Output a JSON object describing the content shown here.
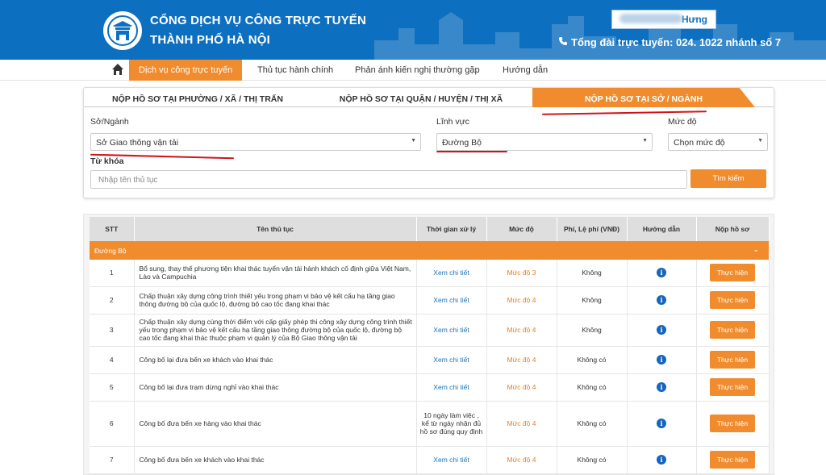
{
  "header": {
    "title_line1": "CỔNG DỊCH VỤ CÔNG TRỰC TUYẾN",
    "title_line2": "THÀNH PHỐ HÀ NỘI",
    "user_name": "Hưng",
    "hotline": "Tổng đài trực tuyến: 024. 1022 nhánh số 7"
  },
  "nav": {
    "items": [
      "Dịch vụ công trực tuyến",
      "Thủ tục hành chính",
      "Phản ánh kiến nghị thường gặp",
      "Hướng dẫn"
    ]
  },
  "tabs": [
    "NỘP HỒ SƠ TẠI PHƯỜNG / XÃ / THỊ TRẤN",
    "NỘP HỒ SƠ TẠI QUẬN / HUYỆN / THỊ XÃ",
    "NỘP HỒ SƠ TẠI SỞ / NGÀNH"
  ],
  "filters": {
    "dept_label": "Sở/Ngành",
    "dept_value": "Sở Giao thông vận tải",
    "field_label": "Lĩnh vực",
    "field_value": "Đường Bộ",
    "level_label": "Mức độ",
    "level_value": "Chọn mức độ",
    "keyword_label": "Từ khóa",
    "keyword_placeholder": "Nhập tên thủ tục",
    "search_button": "Tìm kiếm"
  },
  "table": {
    "headers": [
      "STT",
      "Tên thủ tục",
      "Thời gian xử lý",
      "Mức độ",
      "Phí, Lệ phí (VNĐ)",
      "Hướng dẫn",
      "Nộp hồ sơ"
    ],
    "group": "Đường Bộ",
    "action_label": "Thực hiện",
    "info_glyph": "i",
    "rows": [
      {
        "stt": "1",
        "name": "Bổ sung, thay thế phương tiện khai thác tuyến vận tải hành khách cố định giữa Việt Nam, Lào và Campuchia",
        "time": "Xem chi tiết",
        "level": "Mức độ 3",
        "fee": "Không"
      },
      {
        "stt": "2",
        "name": "Chấp thuận xây dựng công trình thiết yếu trong phạm vi bảo vệ kết cấu hạ tầng giao thông đường bộ của quốc lộ, đường bộ cao tốc đang khai thác",
        "time": "Xem chi tiết",
        "level": "Mức độ 4",
        "fee": "Không"
      },
      {
        "stt": "3",
        "name": "Chấp thuận xây dựng cùng thời điểm với cấp giấy phép thi công xây dựng công trình thiết yếu trong phạm vi bảo vệ kết cấu hạ tầng giao thông đường bộ của quốc lộ, đường bộ cao tốc đang khai thác thuộc phạm vi quản lý của Bộ Giao thông vận tải",
        "time": "Xem chi tiết",
        "level": "Mức độ 4",
        "fee": "Không"
      },
      {
        "stt": "4",
        "name": "Công bố lại đưa bến xe khách vào khai thác",
        "time": "Xem chi tiết",
        "level": "Mức độ 4",
        "fee": "Không có"
      },
      {
        "stt": "5",
        "name": "Công bố lại đưa trạm dừng nghỉ vào khai thác",
        "time": "Xem chi tiết",
        "level": "Mức độ 4",
        "fee": "Không có"
      },
      {
        "stt": "6",
        "name": "Công bố đưa bến xe hàng vào khai thác",
        "time": "10 ngày làm việc , kể từ ngày nhận đủ hồ sơ đúng quy định",
        "level": "Mức độ 4",
        "fee": "Không có"
      },
      {
        "stt": "7",
        "name": "Công bố đưa bến xe khách vào khai thác",
        "time": "Xem chi tiết",
        "level": "Mức độ 4",
        "fee": "Không có"
      }
    ]
  },
  "colors": {
    "brand_blue": "#0d6fbf",
    "accent_orange": "#f08c2e",
    "annotation_red": "#d0141b"
  },
  "icons": [
    "hanoi-logo-icon",
    "phone-icon",
    "home-icon",
    "chevron-down-icon",
    "info-icon"
  ]
}
